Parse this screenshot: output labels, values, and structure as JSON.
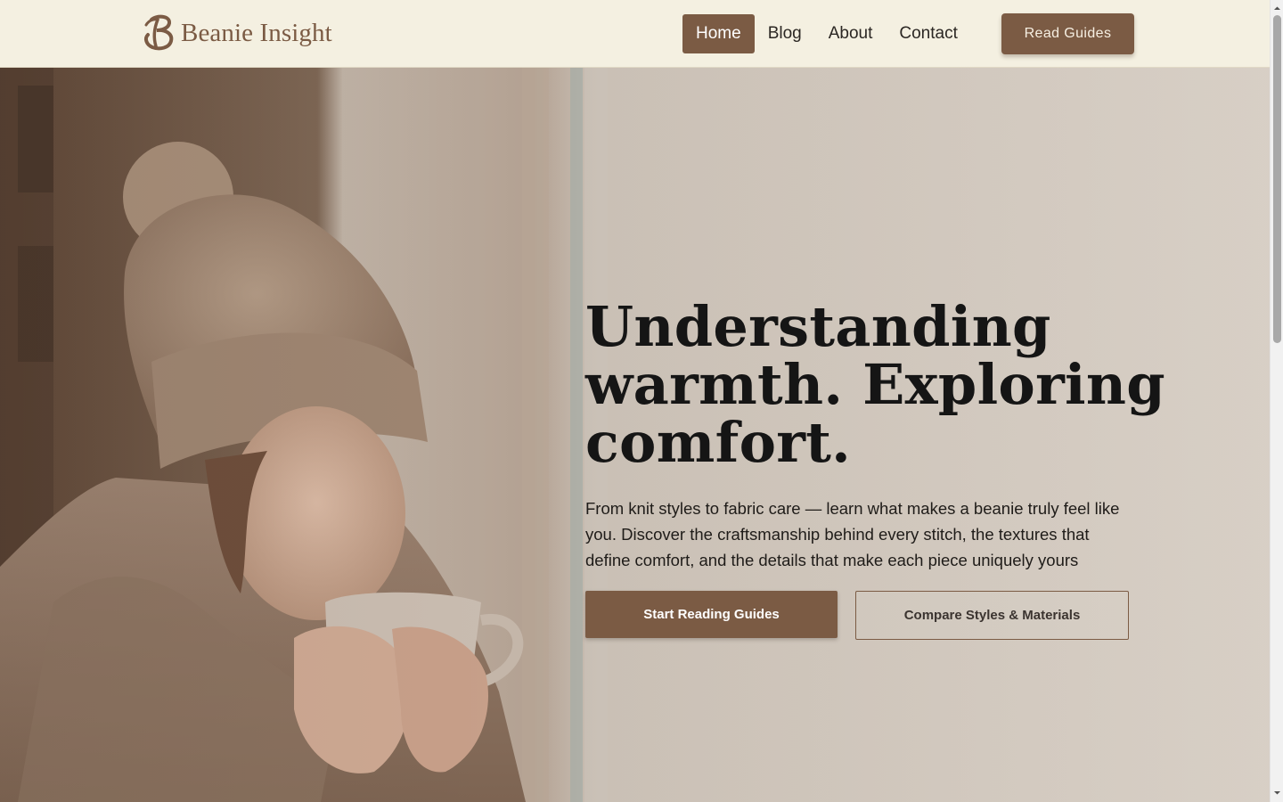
{
  "brand": {
    "name": "Beanie Insight",
    "logo_icon": "script-b-logo-icon",
    "color": "#7b5b44"
  },
  "nav": {
    "items": [
      {
        "label": "Home",
        "active": true
      },
      {
        "label": "Blog",
        "active": false
      },
      {
        "label": "About",
        "active": false
      },
      {
        "label": "Contact",
        "active": false
      }
    ],
    "cta_label": "Read Guides"
  },
  "hero": {
    "headline_line1": "Understanding",
    "headline_line2": "warmth. Exploring",
    "headline_line3": "comfort.",
    "description": "From knit styles to fabric care — learn what makes a beanie truly feel like you. Discover the craftsmanship behind every stitch, the textures that define comfort, and the details that make each piece uniquely yours",
    "primary_button": "Start Reading Guides",
    "secondary_button": "Compare Styles & Materials"
  },
  "colors": {
    "accent": "#7b5b44",
    "topbar_bg": "#f4f0e1",
    "headline": "#151515"
  },
  "icons": {
    "scroll_up": "chevron-up-icon",
    "scroll_down": "chevron-down-icon"
  }
}
